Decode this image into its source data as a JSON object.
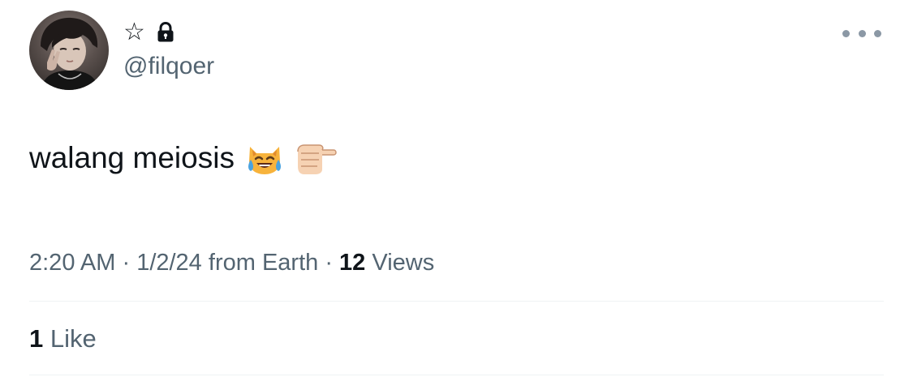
{
  "author": {
    "name_glyph": "☆",
    "handle": "@filqoer",
    "protected": true
  },
  "tweet": {
    "text": "walang meiosis",
    "emojis": [
      "cat-face-with-tears-of-joy-icon",
      "pointing-fist-icon"
    ]
  },
  "meta": {
    "time": "2:20 AM",
    "sep1": " · ",
    "date": "1/2/24",
    "source": " from Earth",
    "sep2": " · ",
    "views_count": "12",
    "views_label": " Views"
  },
  "likes": {
    "count": "1",
    "label": " Like"
  },
  "colors": {
    "text_primary": "#0f1419",
    "text_secondary": "#536471",
    "divider": "#eff3f4",
    "more_dots": "#8b98a5"
  }
}
